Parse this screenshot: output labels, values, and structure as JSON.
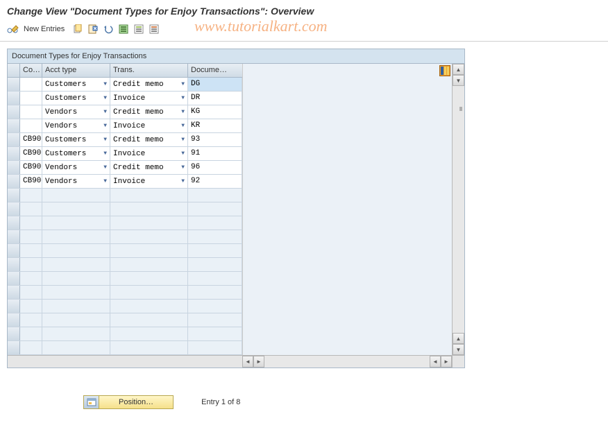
{
  "header": {
    "title": "Change View \"Document Types for Enjoy Transactions\": Overview"
  },
  "toolbar": {
    "new_entries": "New Entries"
  },
  "watermark": "www.tutorialkart.com",
  "panel": {
    "title": "Document Types for Enjoy Transactions"
  },
  "columns": {
    "co": "Co…",
    "acct": "Acct type",
    "trans": "Trans.",
    "doc": "Docume…"
  },
  "rows": [
    {
      "co": "",
      "acct": "Customers",
      "trans": "Credit memo",
      "doc": "DG",
      "doc_hl": true
    },
    {
      "co": "",
      "acct": "Customers",
      "trans": "Invoice",
      "doc": "DR"
    },
    {
      "co": "",
      "acct": "Vendors",
      "trans": "Credit memo",
      "doc": "KG"
    },
    {
      "co": "",
      "acct": "Vendors",
      "trans": "Invoice",
      "doc": "KR"
    },
    {
      "co": "CB90",
      "acct": "Customers",
      "trans": "Credit memo",
      "doc": "93"
    },
    {
      "co": "CB90",
      "acct": "Customers",
      "trans": "Invoice",
      "doc": "91"
    },
    {
      "co": "CB90",
      "acct": "Vendors",
      "trans": "Credit memo",
      "doc": "96"
    },
    {
      "co": "CB90",
      "acct": "Vendors",
      "trans": "Invoice",
      "doc": "92"
    }
  ],
  "empty_rows": 12,
  "footer": {
    "position": "Position…",
    "entry": "Entry 1 of 8"
  }
}
